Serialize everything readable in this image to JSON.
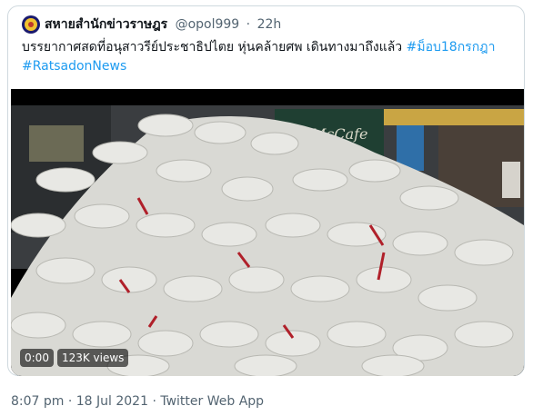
{
  "tweet": {
    "author_name": "สหายสำนักข่าวราษฎร",
    "handle": "@opol999",
    "separator": "·",
    "relative_time": "22h",
    "text_line1_plain": "บรรยากาศสดที่อนุสาวรีย์ประชาธิปไตย หุ่นคล้ายศพ เดินทางมาถึงแล้ว ",
    "hashtag1": "#ม็อบ18กรกฎา",
    "hashtag2": "#RatsadonNews"
  },
  "video": {
    "duration": "0:00",
    "views": "123K views"
  },
  "footer": {
    "timestamp": "8:07 pm · 18 Jul 2021 · Twitter Web App"
  },
  "colors": {
    "link": "#1d9bf0",
    "secondary_text": "#536471",
    "border": "#cfd9de"
  }
}
